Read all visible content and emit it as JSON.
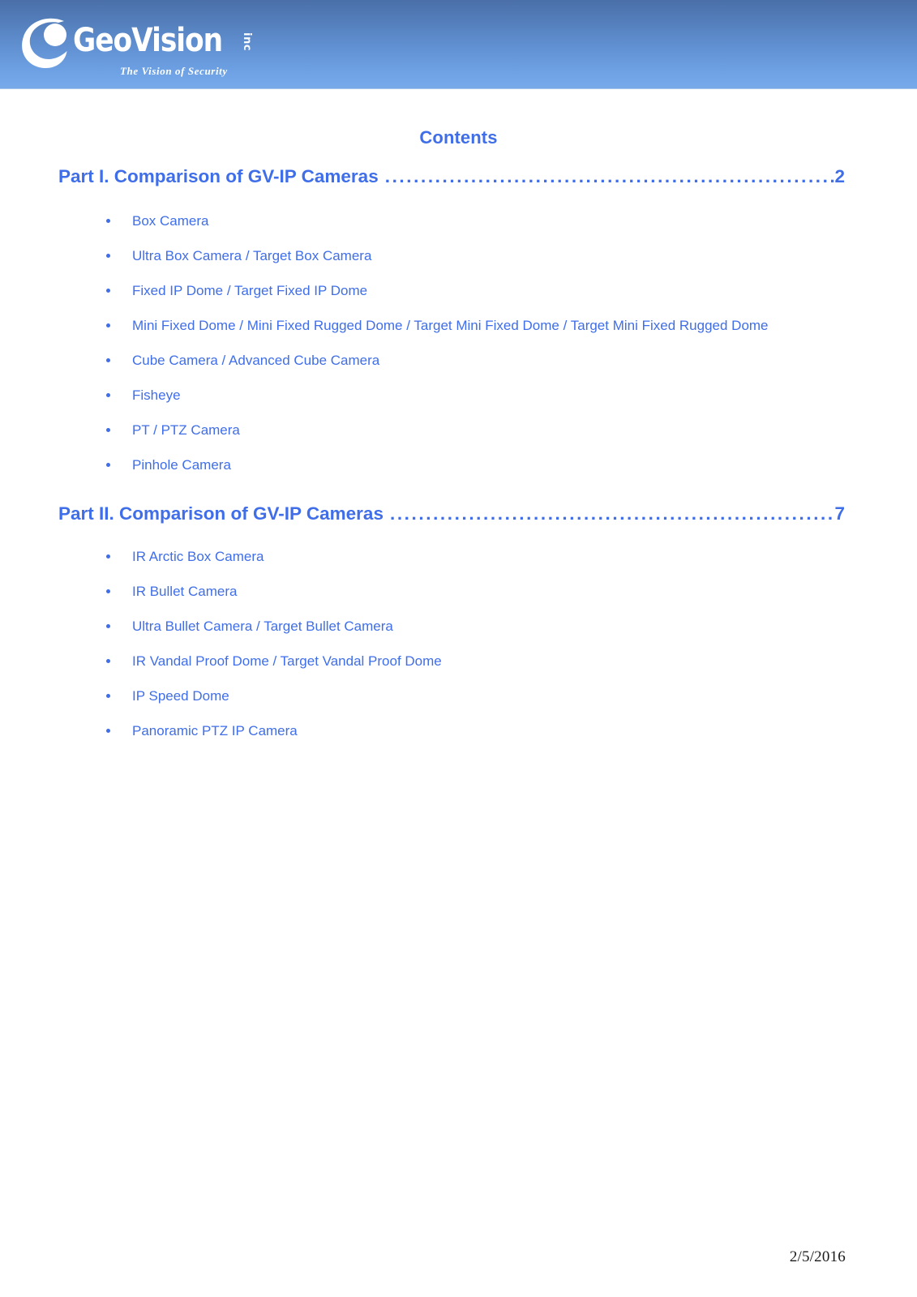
{
  "header": {
    "logo": {
      "mark_icon": "geovision-crescent-logo-icon",
      "wordmark": "GeoVision",
      "suffix": "inc",
      "tagline": "The Vision of Security"
    },
    "banner_gradient_top": "#4a6fa8",
    "banner_gradient_bottom": "#74a8ea"
  },
  "document": {
    "contents_title": "Contents",
    "accent_color": "#3f6ee8",
    "leader_dots": "...................................................................................................................................",
    "parts": [
      {
        "title": "Part I. Comparison of GV-IP Cameras",
        "page": "2",
        "items": [
          "Box Camera",
          "Ultra Box Camera / Target Box Camera",
          "Fixed IP Dome / Target Fixed IP Dome",
          "Mini Fixed Dome / Mini Fixed Rugged Dome / Target Mini Fixed Dome / Target Mini Fixed Rugged Dome",
          "Cube Camera / Advanced Cube Camera",
          "Fisheye",
          "PT / PTZ Camera",
          "Pinhole Camera"
        ]
      },
      {
        "title": "Part II. Comparison of GV-IP Cameras",
        "page": "7",
        "items": [
          "IR Arctic Box Camera",
          "IR Bullet Camera",
          "Ultra Bullet Camera / Target Bullet Camera",
          "IR Vandal Proof Dome / Target Vandal Proof Dome",
          "IP Speed Dome",
          "Panoramic PTZ IP Camera"
        ]
      }
    ]
  },
  "footer": {
    "date": "2/5/2016"
  }
}
